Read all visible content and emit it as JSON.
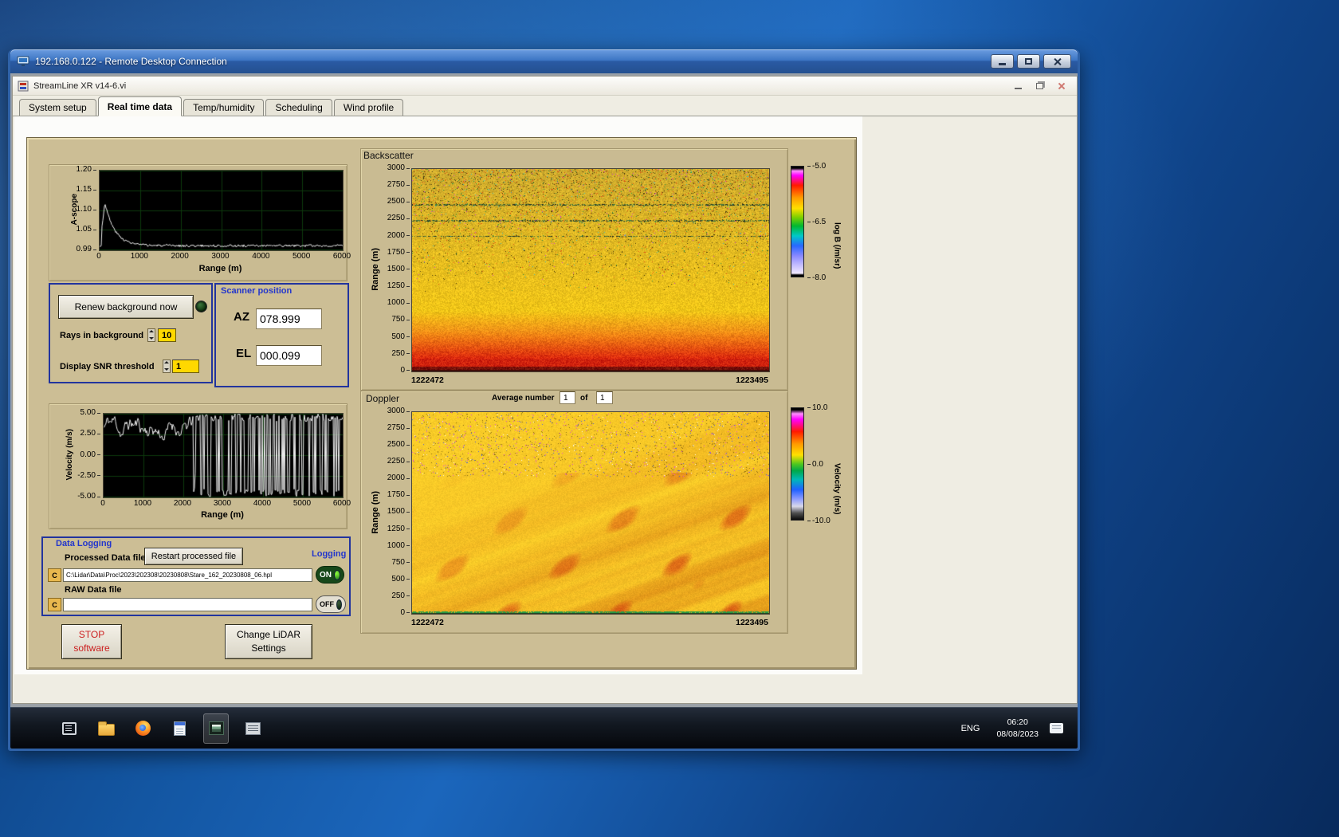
{
  "rdp": {
    "title": "192.168.0.122 - Remote Desktop Connection"
  },
  "app": {
    "title": "StreamLine XR v14-6.vi",
    "tabs": [
      "System setup",
      "Real time data",
      "Temp/humidity",
      "Scheduling",
      "Wind profile"
    ],
    "active_tab": "Real time data"
  },
  "ascope": {
    "ylabel": "A-scope",
    "xlabel": "Range (m)",
    "yticks": [
      "1.20",
      "1.15",
      "1.10",
      "1.05",
      "0.99"
    ],
    "xticks": [
      "0",
      "1000",
      "2000",
      "3000",
      "4000",
      "5000",
      "6000"
    ]
  },
  "renew": {
    "button_label": "Renew background now",
    "rays_label": "Rays in background",
    "rays_value": "10",
    "snr_label": "Display SNR threshold",
    "snr_value": "1"
  },
  "scanner": {
    "title": "Scanner position",
    "az_label": "AZ",
    "az_value": "078.999",
    "el_label": "EL",
    "el_value": "000.099"
  },
  "backscatter": {
    "title": "Backscatter",
    "ylabel": "Range (m)",
    "yticks": [
      "3000",
      "2750",
      "2500",
      "2250",
      "2000",
      "1750",
      "1500",
      "1250",
      "1000",
      "750",
      "500",
      "250",
      "0"
    ],
    "xticks": [
      "1222472",
      "1223495"
    ],
    "cbar_ticks": [
      "-5.0",
      "-6.5",
      "-8.0"
    ],
    "cbar_label": "log B (/m/sr)",
    "cbar_gradient": "linear-gradient(180deg,#000000 0px,#000000 2px,#ff8cff 4%,#ff00ff 8%,#ff1a00 17%,#ff9800 28%,#ffe000 38%,#7ed000 46%,#00b830 54%,#00c8c8 63%,#2868ff 72%,#8888ff 81%,#c8c0ff 90%,#efe8ff 97%,#000000 calc(100% - 2px),#000000 100%)"
  },
  "doppler": {
    "title": "Doppler",
    "avg_label": "Average number",
    "avg_value": "1",
    "of_label": "of",
    "of_count": "1",
    "ylabel": "Range (m)",
    "yticks": [
      "3000",
      "2750",
      "2500",
      "2250",
      "2000",
      "1750",
      "1500",
      "1250",
      "1000",
      "750",
      "500",
      "250",
      "0"
    ],
    "xticks": [
      "1222472",
      "1223495"
    ],
    "cbar_ticks": [
      "10.0",
      "0.0",
      "-10.0"
    ],
    "cbar_label": "Velocity (m/s)",
    "cbar_gradient": "linear-gradient(180deg,#000000 0px,#000000 2px,#ff8cff 5%,#ff00ff 10%,#ff1a00 21%,#ff9800 32%,#ffe000 42%,#50c81e 50%,#00a848 56%,#00b8b8 64%,#2060ff 73%,#8898ff 81%,#d8d8ea 88%,#505050 94%,#0a0a0a 100%)"
  },
  "velocity": {
    "ylabel": "Velocity (m/s)",
    "xlabel": "Range (m)",
    "yticks": [
      "5.00",
      "2.50",
      "0.00",
      "-2.50",
      "-5.00"
    ],
    "xticks": [
      "0",
      "1000",
      "2000",
      "3000",
      "4000",
      "5000",
      "6000"
    ]
  },
  "datalog": {
    "title": "Data Logging",
    "processed_label": "Processed Data file",
    "restart_button": "Restart processed file",
    "logging_label": "Logging",
    "drive": "C",
    "processed_path": "C:\\Lidar\\Data\\Proc\\2023\\202308\\20230808\\Stare_162_20230808_06.hpl",
    "raw_label": "RAW Data file",
    "raw_path": "",
    "on_label": "ON",
    "off_label": "OFF"
  },
  "buttons": {
    "stop_line1": "STOP",
    "stop_line2": "software",
    "change_line1": "Change LiDAR",
    "change_line2": "Settings"
  },
  "taskbar": {
    "lang": "ENG",
    "time": "06:20",
    "date": "08/08/2023",
    "icons": [
      "taskview-icon",
      "folder-icon",
      "firefox-icon",
      "notepad-icon",
      "streamline-app-icon",
      "scan-scheduler-icon",
      "chat-icon"
    ]
  },
  "colors": {
    "panel_tan": "#ccbe95",
    "group_border_blue": "#22349e",
    "blue_label": "#2336cc",
    "control_yellow": "#ffd800",
    "stop_red": "#cc2020",
    "on_green": "#17481a"
  },
  "chart_data": [
    {
      "id": "ascope-canvas",
      "type": "line",
      "title": "A-scope",
      "xlabel": "Range (m)",
      "ylabel": "A-scope",
      "x_range": [
        0,
        6000
      ],
      "y_range": [
        0.99,
        1.2
      ],
      "points": [
        [
          0,
          1.0
        ],
        [
          100,
          1.09
        ],
        [
          150,
          1.11
        ],
        [
          300,
          1.06
        ],
        [
          500,
          1.03
        ],
        [
          800,
          1.01
        ],
        [
          1000,
          1.005
        ],
        [
          2000,
          1.0
        ],
        [
          3000,
          1.0
        ],
        [
          4000,
          1.0
        ],
        [
          5000,
          1.0
        ],
        [
          6000,
          1.0
        ]
      ],
      "note": "sharp peak near 150 m decaying to baseline 1.0 with small noise; dark plot, white trace, dim green grid"
    },
    {
      "id": "velocity-canvas",
      "type": "line",
      "title": "Velocity vs range",
      "xlabel": "Range (m)",
      "ylabel": "Velocity (m/s)",
      "x_range": [
        0,
        6000
      ],
      "y_range": [
        -5,
        5
      ],
      "note": "0-2300 m: noisy trace around +3.3 m/s (2.1 to 4.9); beyond 2300 m: saturated random oscillation filling -5 to +5 with occasional flat gaps"
    },
    {
      "id": "backscatter-canvas",
      "type": "heatmap",
      "title": "Backscatter",
      "x_range": [
        1222472,
        1223495
      ],
      "y_range": [
        0,
        3000
      ],
      "value_label": "log B (/m/sr)",
      "value_range": [
        -8.0,
        -5.0
      ],
      "note": "yellow field ~ -6.5 with dense dark/red/green speckle noise aloft, green streak rows near 2250/2000/1500 m, bright orange-red band below 500 m (~ -5), dark red floor at 0 m"
    },
    {
      "id": "doppler-canvas",
      "type": "heatmap",
      "title": "Doppler",
      "x_range": [
        1222472,
        1223495
      ],
      "y_range": [
        0,
        3000
      ],
      "value_label": "Velocity (m/s)",
      "value_range": [
        -10.0,
        10.0
      ],
      "note": "smooth yellow-orange field (~ +2 to +4 m/s) with diagonal darker orange/red streaks rising left-to-right, magenta/blue speckles above 2000 m, thin green line at 0 m"
    }
  ]
}
